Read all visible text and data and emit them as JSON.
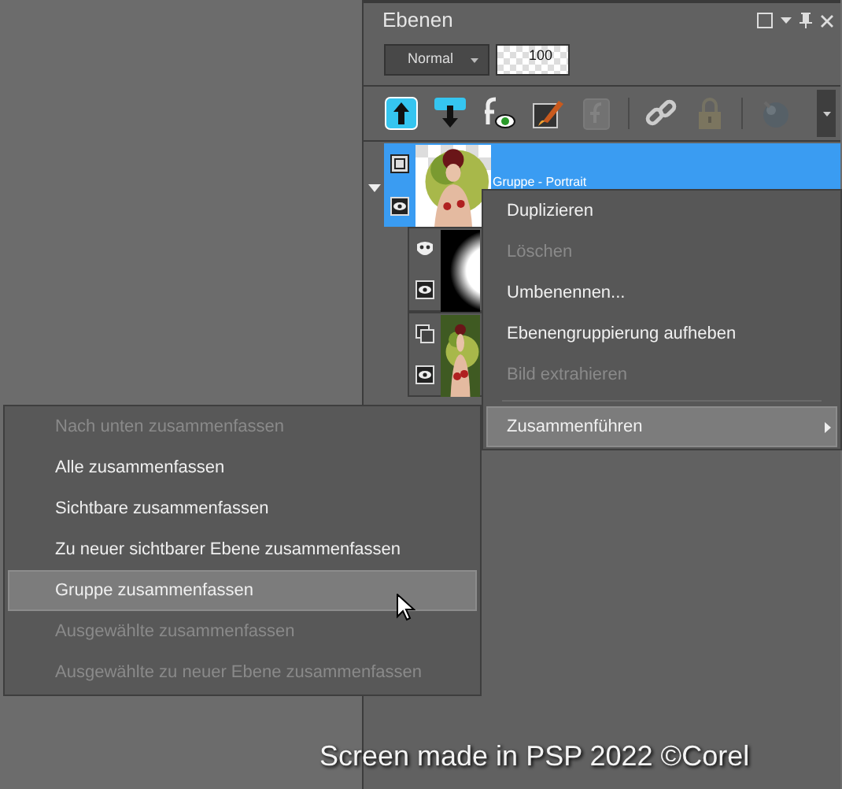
{
  "panel": {
    "title": "Ebenen",
    "blend_mode": "Normal",
    "opacity": "100"
  },
  "toolbar": [
    {
      "kind": "new-layer",
      "disabled": false
    },
    {
      "kind": "new-layer-below",
      "disabled": false
    },
    {
      "kind": "effects",
      "disabled": false
    },
    {
      "kind": "brush",
      "disabled": false
    },
    {
      "kind": "script",
      "disabled": true
    },
    {
      "kind": "separator"
    },
    {
      "kind": "link",
      "disabled": false
    },
    {
      "kind": "lock",
      "disabled": true
    },
    {
      "kind": "separator"
    },
    {
      "kind": "sphere",
      "disabled": true
    }
  ],
  "layers": [
    {
      "name": "Gruppe - Portrait",
      "kind": "group",
      "selected": true,
      "expanded": true,
      "children": [
        {
          "kind": "mask",
          "selected": false
        },
        {
          "kind": "raster",
          "selected": false
        }
      ]
    }
  ],
  "context_menu": [
    {
      "kind": "item",
      "label": "Duplizieren",
      "disabled": false,
      "selected": false
    },
    {
      "kind": "item",
      "label": "Löschen",
      "disabled": true,
      "selected": false
    },
    {
      "kind": "item",
      "label": "Umbenennen...",
      "disabled": false,
      "selected": false
    },
    {
      "kind": "item",
      "label": "Ebenengruppierung aufheben",
      "disabled": false,
      "selected": false
    },
    {
      "kind": "item",
      "label": "Bild extrahieren",
      "disabled": true,
      "selected": false
    },
    {
      "kind": "separator"
    },
    {
      "kind": "submenu",
      "label": "Zusammenführen",
      "disabled": false,
      "selected": true
    }
  ],
  "submenu": [
    {
      "label": "Nach unten zusammenfassen",
      "disabled": true,
      "selected": false
    },
    {
      "label": "Alle zusammenfassen",
      "disabled": false,
      "selected": false
    },
    {
      "label": "Sichtbare zusammenfassen",
      "disabled": false,
      "selected": false
    },
    {
      "label": "Zu neuer sichtbarer Ebene zusammenfassen",
      "disabled": false,
      "selected": false
    },
    {
      "label": "Gruppe zusammenfassen",
      "disabled": false,
      "selected": true
    },
    {
      "label": "Ausgewählte zusammenfassen",
      "disabled": true,
      "selected": false
    },
    {
      "label": "Ausgewählte zu neuer Ebene zusammenfassen",
      "disabled": true,
      "selected": false
    }
  ],
  "caption": "Screen made in PSP 2022 ©Corel"
}
